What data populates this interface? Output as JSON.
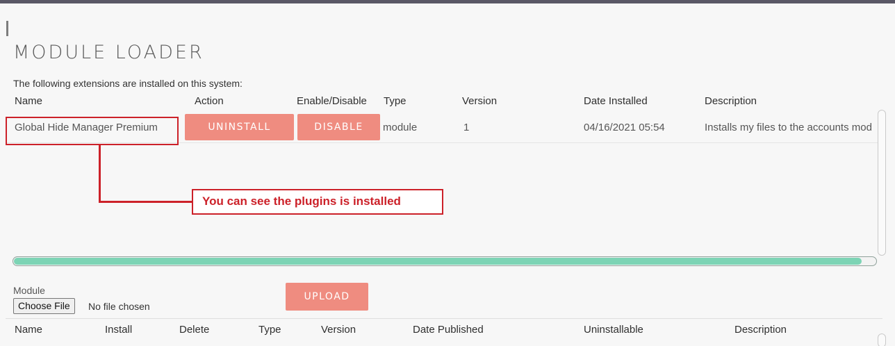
{
  "page": {
    "title": "MODULE LOADER",
    "intro": "The following extensions are installed on this system:"
  },
  "installed_table": {
    "headers": [
      "Name",
      "Action",
      "Enable/Disable",
      "Type",
      "Version",
      "Date Installed",
      "Description"
    ],
    "rows": [
      {
        "name": "Global Hide Manager Premium",
        "action_label": "UNINSTALL",
        "toggle_label": "DISABLE",
        "type": "module",
        "version": "1",
        "date_installed": "04/16/2021 05:54",
        "description": "Installs my files to the accounts mod"
      }
    ]
  },
  "annotation": {
    "callout_text": "You can see the plugins is installed",
    "color": "#cc2129"
  },
  "upload": {
    "module_label": "Module",
    "choose_file_label": "Choose File",
    "no_file_text": "No file chosen",
    "upload_label": "UPLOAD"
  },
  "available_table": {
    "headers": [
      "Name",
      "Install",
      "Delete",
      "Type",
      "Version",
      "Date Published",
      "Uninstallable",
      "Description"
    ]
  },
  "colors": {
    "button": "#ef8c80",
    "scrollbar_thumb": "#7dd4b5",
    "topbar": "#5a5866"
  }
}
